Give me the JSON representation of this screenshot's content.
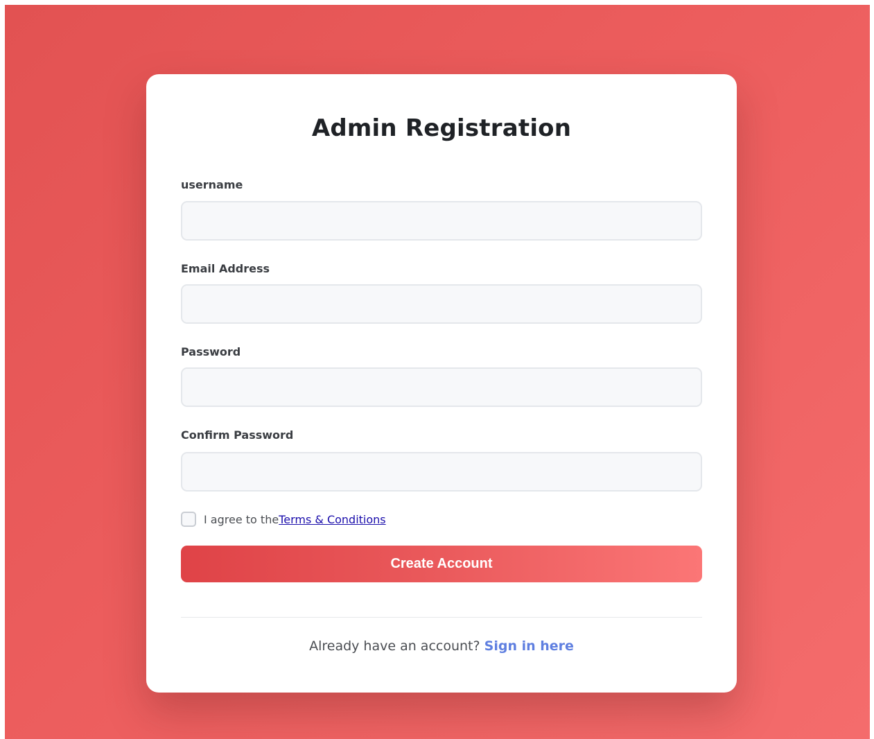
{
  "form": {
    "title": "Admin Registration",
    "fields": [
      {
        "label": "username",
        "value": "",
        "placeholder": ""
      },
      {
        "label": "Email Address",
        "value": "",
        "placeholder": ""
      },
      {
        "label": "Password",
        "value": "",
        "placeholder": ""
      },
      {
        "label": "Confirm Password",
        "value": "",
        "placeholder": ""
      }
    ],
    "terms": {
      "prefix": "I agree to the",
      "link_label": "Terms & Conditions",
      "checked": false
    },
    "submit_label": "Create Account",
    "footer": {
      "prompt": "Already have an account?",
      "link_label": "Sign in here"
    }
  },
  "colors": {
    "background_start": "#e25252",
    "background_end": "#f46c6c",
    "button_start": "#df4347",
    "button_end": "#fb7676",
    "terms_link": "#1a0dab",
    "signin_link": "#5f7fe0"
  }
}
